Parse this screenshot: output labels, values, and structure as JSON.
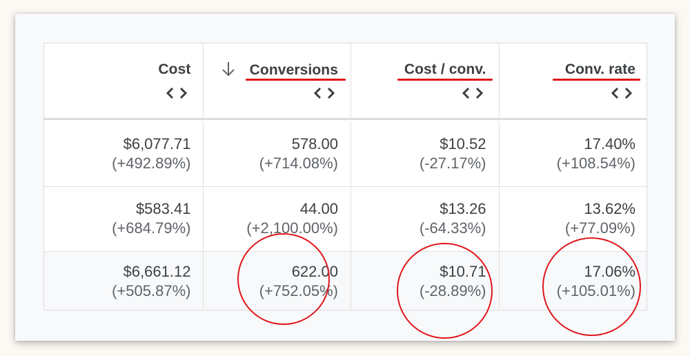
{
  "table": {
    "columns": [
      {
        "key": "cost",
        "label": "Cost",
        "sorted": false,
        "annotated": false
      },
      {
        "key": "conversions",
        "label": "Conversions",
        "sorted": true,
        "sort_direction": "descending",
        "annotated": true
      },
      {
        "key": "cost_per_conv",
        "label": "Cost / conv.",
        "sorted": false,
        "annotated": true
      },
      {
        "key": "conv_rate",
        "label": "Conv. rate",
        "sorted": false,
        "annotated": true
      }
    ],
    "rows": [
      {
        "type": "data",
        "cells": [
          {
            "value": "$6,077.71",
            "change": "(+492.89%)"
          },
          {
            "value": "578.00",
            "change": "(+714.08%)"
          },
          {
            "value": "$10.52",
            "change": "(-27.17%)"
          },
          {
            "value": "17.40%",
            "change": "(+108.54%)"
          }
        ]
      },
      {
        "type": "data",
        "cells": [
          {
            "value": "$583.41",
            "change": "(+684.79%)"
          },
          {
            "value": "44.00",
            "change": "(+2,100.00%)"
          },
          {
            "value": "$13.26",
            "change": "(-64.33%)"
          },
          {
            "value": "13.62%",
            "change": "(+77.09%)"
          }
        ]
      },
      {
        "type": "total",
        "cells": [
          {
            "value": "$6,661.12",
            "change": "(+505.87%)"
          },
          {
            "value": "622.00",
            "change": "(+752.05%)",
            "circled": true
          },
          {
            "value": "$10.71",
            "change": "(-28.89%)",
            "circled": true
          },
          {
            "value": "17.06%",
            "change": "(+105.01%)",
            "circled": true
          }
        ]
      }
    ]
  },
  "icons": {
    "sort": "arrow-down-icon",
    "column_resize": "chevron-left-right-icon"
  },
  "colors": {
    "page_background": "#fcf9f4",
    "card_background": "#f8f9fa",
    "header_text": "#3c4043",
    "value_text": "#3c4043",
    "change_text": "#5f6368",
    "annotation_red": "#e0161b",
    "total_row_background": "#f8f9fa"
  }
}
